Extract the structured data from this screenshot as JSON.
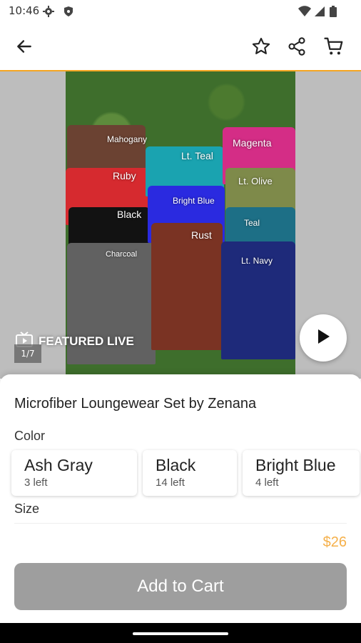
{
  "status": {
    "time": "10:46",
    "icons": [
      "gear-icon",
      "shield-icon",
      "wifi-icon",
      "signal-icon",
      "battery-icon"
    ]
  },
  "topbar": {
    "icons": [
      "back-arrow-icon",
      "star-icon",
      "share-icon",
      "cart-icon"
    ]
  },
  "media": {
    "featured_label": "FEATURED LIVE",
    "counter": "1/7",
    "shirt_labels": [
      "Mahogany",
      "Lt. Teal",
      "Magenta",
      "Ruby",
      "Bright Blue",
      "Lt. Olive",
      "Black",
      "Teal",
      "Rust",
      "Charcoal",
      "Lt. Navy"
    ]
  },
  "product": {
    "title": "Microfiber Loungewear Set by Zenana",
    "color_label": "Color",
    "size_label": "Size",
    "colors": [
      {
        "name": "Ash Gray",
        "stock": "3 left"
      },
      {
        "name": "Black",
        "stock": "14 left"
      },
      {
        "name": "Bright Blue",
        "stock": "4 left"
      }
    ],
    "price": "$26",
    "cta": "Add to Cart"
  },
  "colors": {
    "accent": "#f5a623",
    "price": "#f5b04a",
    "cta_bg": "#9e9e9e"
  }
}
